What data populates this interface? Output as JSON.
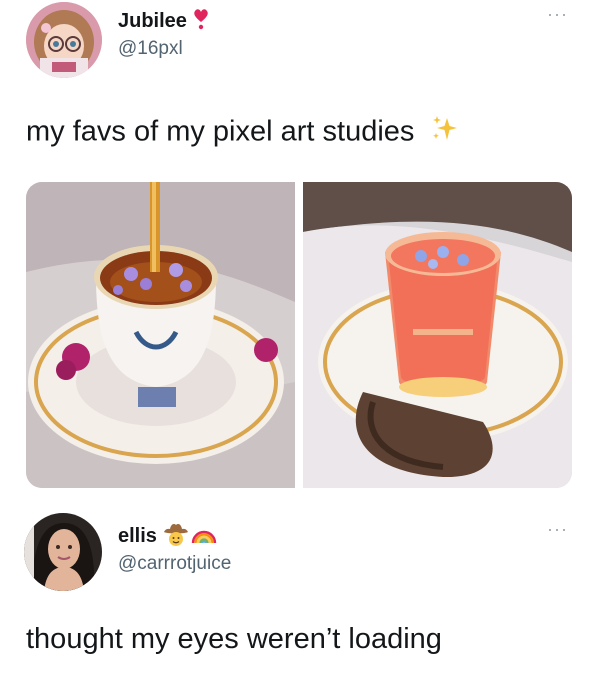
{
  "tweets": [
    {
      "display_name": "Jubilee",
      "handle": "@16pxl",
      "text": "my favs of my pixel art studies",
      "name_badge_icon": "heart-exclamation-icon",
      "text_emoji_icon": "sparkles-icon",
      "media": [
        {
          "icon": "teacup-pixel-art-image"
        },
        {
          "icon": "glass-drink-pixel-art-image"
        }
      ]
    },
    {
      "display_name": "ellis",
      "handle": "@carrrotjuice",
      "text": "thought my eyes weren’t loading",
      "name_badge_icons": [
        "cowboy-face-icon",
        "rainbow-icon"
      ]
    }
  ],
  "more_menu_label": "···",
  "colors": {
    "text_primary": "#14171a",
    "text_secondary": "#536471",
    "more_dots": "#9aa5ae"
  }
}
